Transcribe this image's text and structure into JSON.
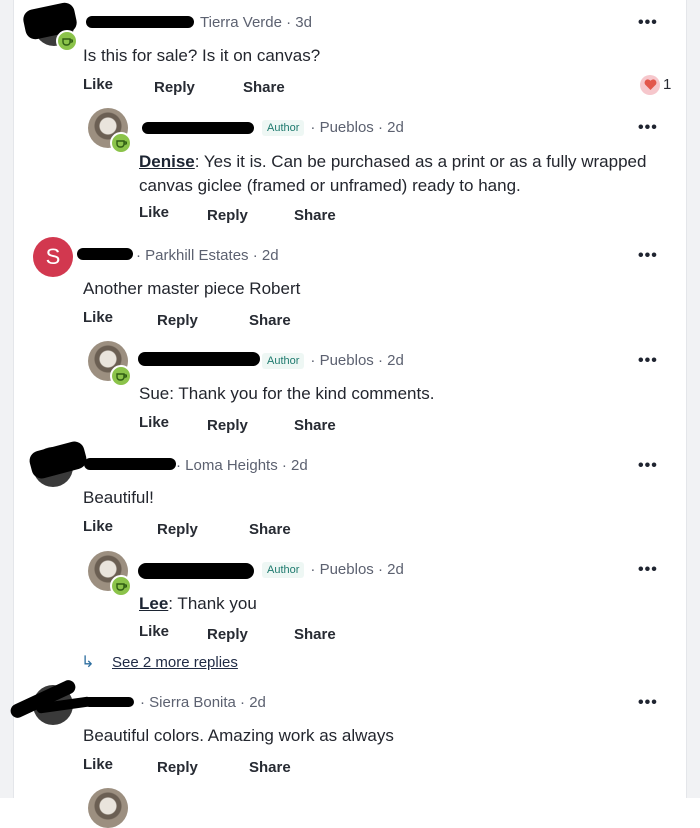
{
  "actions": {
    "like": "Like",
    "reply": "Reply",
    "share": "Share"
  },
  "author_label": "Author",
  "more_icon": "•••",
  "comments": [
    {
      "meta": "Tierra Verde · 3d",
      "text": "Is this for sale? Is it on canvas?",
      "likes": "1"
    },
    {
      "meta": "· Pueblos · 2d",
      "mention": "Denise",
      "text_rest": ":  Yes it is.  Can be purchased as a print or as a fully wrapped canvas giclee (framed or unframed) ready to hang."
    },
    {
      "initial": "S",
      "meta": "· Parkhill Estates · 2d",
      "text": "Another master piece Robert"
    },
    {
      "meta": "· Pueblos · 2d",
      "text": "Sue:  Thank you for the kind comments."
    },
    {
      "meta": "· Loma Heights · 2d",
      "text": "Beautiful!"
    },
    {
      "meta": "· Pueblos · 2d",
      "mention": "Lee",
      "text_rest": ":  Thank you"
    },
    {
      "meta": "· Sierra Bonita · 2d",
      "text": "Beautiful colors. Amazing work as always"
    }
  ],
  "see_more": "See 2 more replies",
  "colors": {
    "badge": "#8bc34a",
    "avatar_s": "#d2384f",
    "heart": "#e2574c",
    "author_tag_text": "#1e7a6e"
  }
}
